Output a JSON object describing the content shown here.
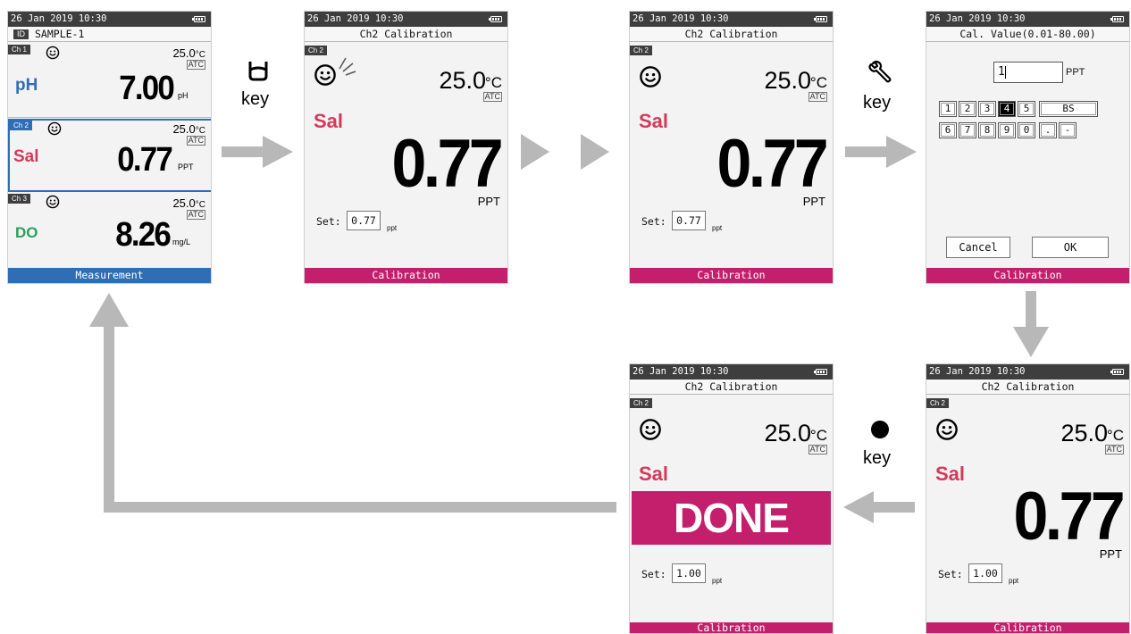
{
  "status": {
    "datetime": "26 Jan 2019  10:30"
  },
  "colors": {
    "measurement": "#2f6db5",
    "calibration": "#c41f6c",
    "ph": "#2f6db5",
    "sal": "#d23a5a",
    "do": "#2aa05a",
    "arrow": "#b8b8b8"
  },
  "screen1": {
    "sample_id_tag": "ID",
    "sample_id": "SAMPLE-1",
    "ch1": {
      "tag": "Ch 1",
      "param": "pH",
      "temp": "25.0",
      "temp_unit": "°C",
      "atc": "ATC",
      "value": "7.00",
      "unit": "pH"
    },
    "ch2": {
      "tag": "Ch 2",
      "param": "Sal",
      "temp": "25.0",
      "temp_unit": "°C",
      "atc": "ATC",
      "value": "0.77",
      "unit": "PPT"
    },
    "ch3": {
      "tag": "Ch 3",
      "param": "DO",
      "temp": "25.0",
      "temp_unit": "°C",
      "atc": "ATC",
      "value": "8.26",
      "unit": "mg/L"
    },
    "footer": "Measurement"
  },
  "key1": {
    "icon": "beaker-icon",
    "label": "key"
  },
  "key2": {
    "icon": "wrench-icon",
    "label": "key"
  },
  "key3": {
    "icon": "dot-icon",
    "label": "key"
  },
  "cal": {
    "title": "Ch2 Calibration",
    "ch_tag": "Ch 2",
    "param": "Sal",
    "temp": "25.0",
    "temp_unit": "°C",
    "atc": "ATC",
    "value": "0.77",
    "unit": "PPT",
    "set_label": "Set:",
    "set_unit": "ppt",
    "set_value_before": "0.77",
    "set_value_after": "1.00",
    "done": "DONE",
    "footer": "Calibration"
  },
  "entry": {
    "title": "Cal. Value(0.01-80.00)",
    "input_value": "1",
    "input_unit": "PPT",
    "keys_row1": [
      "1",
      "2",
      "3",
      "4",
      "5",
      "BS"
    ],
    "keys_row2": [
      "6",
      "7",
      "8",
      "9",
      "0",
      ".",
      "-"
    ],
    "selected_key": "4",
    "cancel": "Cancel",
    "ok": "OK",
    "footer": "Calibration"
  }
}
